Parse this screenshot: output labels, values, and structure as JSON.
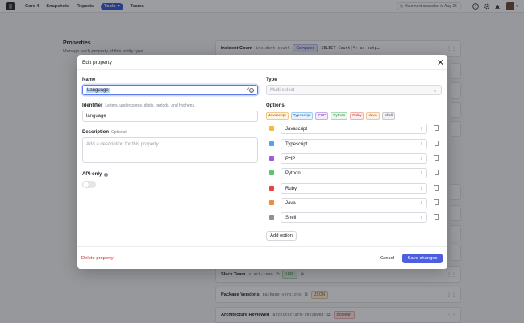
{
  "nav": {
    "links": [
      "Core 4",
      "Snapshots",
      "Reports",
      "Tools",
      "Teams"
    ],
    "active_link": "Tools",
    "snapshot_notice": "Your next snapshot is Aug 25"
  },
  "page": {
    "heading": "Properties",
    "subtitle": "Manage each property of this entity type.",
    "rows": [
      {
        "name": "Incident Count",
        "code": "incident-count",
        "tag": "Computed",
        "extra": "SELECT Count(*) as outp…"
      },
      {
        "name": "Slack Team",
        "code": "slack-team",
        "tag": "URL"
      },
      {
        "name": "Package Versions",
        "code": "package-versions",
        "tag": "JSON"
      },
      {
        "name": "Architecture Reviewed",
        "code": "architecture-reviewed",
        "tag": "Boolean"
      }
    ]
  },
  "modal": {
    "title": "Edit property",
    "name_label": "Name",
    "name_value": "Language",
    "identifier_label": "Identifier",
    "identifier_hint": "Letters, underscores, digits, periods, and hyphens.",
    "identifier_value": "language",
    "description_label": "Description",
    "description_hint": "Optional",
    "description_placeholder": "Add a description for this property",
    "api_only_label": "API-only",
    "api_only_on": false,
    "type_label": "Type",
    "type_value": "Multi-select",
    "options_label": "Options",
    "options": [
      {
        "label": "Javascript",
        "color": "#f5b942"
      },
      {
        "label": "Typescript",
        "color": "#4aa8f0"
      },
      {
        "label": "PHP",
        "color": "#9b59e8"
      },
      {
        "label": "Python",
        "color": "#5cc46a"
      },
      {
        "label": "Ruby",
        "color": "#e2463c"
      },
      {
        "label": "Java",
        "color": "#f08a3c"
      },
      {
        "label": "Shell",
        "color": "#8d9096"
      }
    ],
    "add_option_label": "Add option",
    "delete_label": "Delete property",
    "cancel_label": "Cancel",
    "save_label": "Save changes"
  }
}
